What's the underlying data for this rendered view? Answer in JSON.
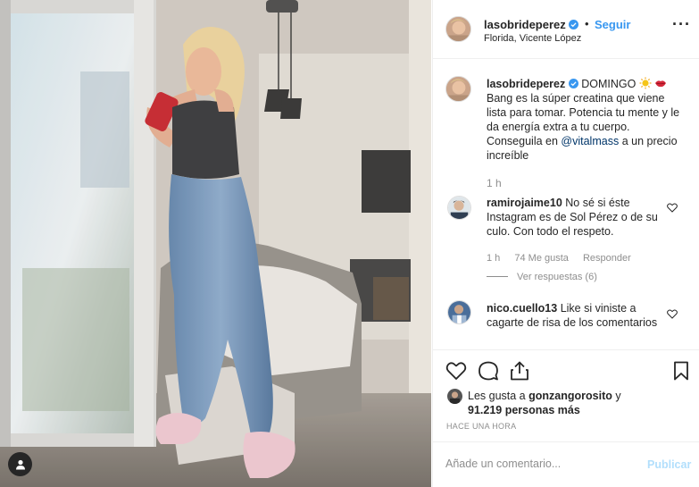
{
  "post": {
    "username": "lasobrideperez",
    "separator": "•",
    "follow_label": "Seguir",
    "location": "Florida, Vicente López",
    "more_label": "···"
  },
  "caption": {
    "username": "lasobrideperez",
    "text_1": "DOMINGO",
    "text_2": "Bang es la súper creatina que viene lista para tomar. Potencia tu mente y le da energía extra a tu cuerpo. Conseguila en",
    "mention": "@vitalmass",
    "text_3": "a un precio increíble",
    "time": "1 h",
    "emojis": [
      "sun-emoji",
      "lips-emoji"
    ]
  },
  "comments": [
    {
      "username": "ramirojaime10",
      "text": "No sé si éste Instagram es de Sol Pérez o de su culo. Con todo el respeto.",
      "time": "1 h",
      "likes": "74 Me gusta",
      "reply_label": "Responder",
      "view_replies": "Ver respuestas (6)"
    },
    {
      "username": "nico.cuello13",
      "text": "Like si viniste a cagarte de risa de los comentarios"
    }
  ],
  "likes": {
    "prefix": "Les gusta a",
    "user": "gonzangorosito",
    "conj": "y",
    "count": "91.219 personas más"
  },
  "time_ago": "HACE UNA HORA",
  "composer": {
    "placeholder": "Añade un comentario...",
    "publish_label": "Publicar"
  },
  "colors": {
    "link_blue": "#3897f0",
    "mention_blue": "#003569",
    "muted": "#8e8e8e",
    "publish_disabled": "#b2dffc"
  }
}
